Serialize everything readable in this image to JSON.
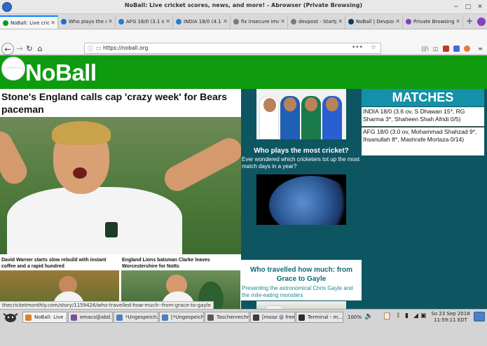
{
  "window": {
    "title": "NoBall: Live cricket scores, news, and more! - Abrowser (Private Browsing)",
    "controls": [
      "−",
      "□",
      "✕"
    ]
  },
  "tabs": [
    {
      "label": "NoBall: Live cricket",
      "color": "#0f9b0f",
      "active": true
    },
    {
      "label": "Who plays the most",
      "color": "#1b6fc7",
      "active": false
    },
    {
      "label": "AFG 18/0 (3.1 ov",
      "color": "#2a7bd6",
      "active": false
    },
    {
      "label": "INDIA 18/0 (4.1 ov",
      "color": "#2a7bd6",
      "active": false
    },
    {
      "label": "fix insecure imag",
      "color": "#7a7a7a",
      "active": false
    },
    {
      "label": "devpost - Startp",
      "color": "#7a7a7a",
      "active": false
    },
    {
      "label": "NoBall | Devpost",
      "color": "#0a3b5a",
      "active": false
    },
    {
      "label": "Private Browsing",
      "color": "#8b3fb8",
      "active": false
    }
  ],
  "tab_plus": "+",
  "nav": {
    "back": "←",
    "forward": "→",
    "reload": "↻",
    "home": "⌂",
    "url": "https://noball.org",
    "info_icon": "ⓘ",
    "lock_icon": "🔒",
    "page_actions": "•••",
    "bookmark": "☆",
    "library": "|||\\",
    "sidebar": "◫",
    "menu": "≡"
  },
  "site": {
    "brand": "NoBall",
    "headline": "Stone's England calls cap 'crazy week' for Bears paceman",
    "sub_stories": [
      "David Warner starts slow rebuild with instant coffee and a rapid hundred",
      "England Lions batsman Clarke leaves Worcestershire for Notts"
    ],
    "features": [
      {
        "title": "Who plays the most cricket?",
        "desc": "Ever wondered which cricketers tot up the most match days in a year?"
      },
      {
        "title": "Who travelled how much: from Grace to Gayle",
        "desc": "Presenting the astronomical Chris Gayle and the mile-eating monsters"
      }
    ],
    "matches_title": "MATCHES",
    "matches": [
      "INDIA 18/0 (3.6 ov, S Dhawan 15*, RG Sharma 3*, Shaheen Shah Afridi 0/5)",
      "AFG 18/0 (3.0 ov, Mohammad Shahzad 9*, Ihsanullah 8*, Mashrafe Mortaza 0/14)"
    ]
  },
  "status_url": "thecricketmonthly.com/story/1159426/who-travelled-how-much--from-grace-to-gayle",
  "taskbar": {
    "tasks": [
      {
        "label": "NoBall: Live ...",
        "color": "#d9822b"
      },
      {
        "label": "emacs@abd...",
        "color": "#7b4fa0"
      },
      {
        "label": "*Ungespeich...",
        "color": "#4d7fb8"
      },
      {
        "label": "[*Ungespeich...",
        "color": "#4d7fb8"
      },
      {
        "label": "Taschenrechner",
        "color": "#5a5a5a"
      },
      {
        "label": "[moaz @ free...",
        "color": "#3a3a3a"
      },
      {
        "label": "Terminal - m...",
        "color": "#2b2b2b"
      }
    ],
    "battery": "100%",
    "clock_date": "So 23 Sep 2018",
    "clock_time": "11:59:11 EDT"
  }
}
